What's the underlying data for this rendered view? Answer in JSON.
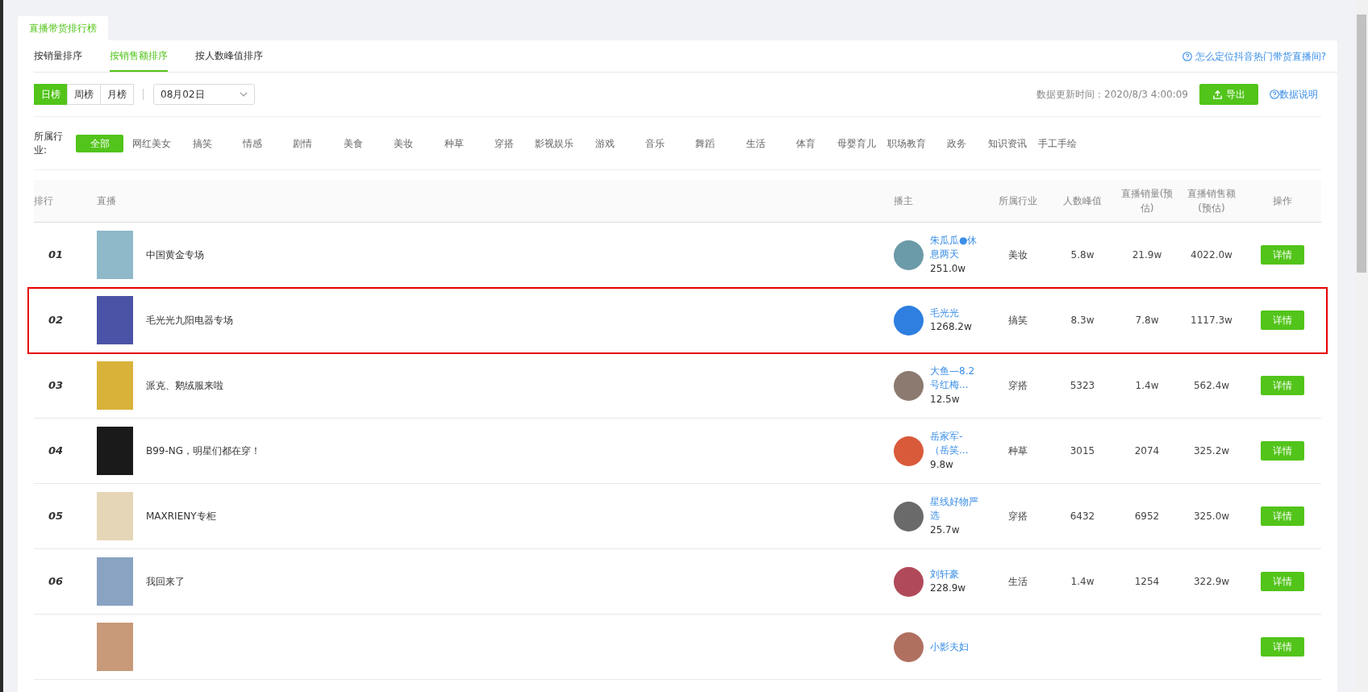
{
  "page_tab": {
    "label": "直播带货排行榜"
  },
  "sort_tabs": [
    {
      "label": "按销量排序",
      "selected": false
    },
    {
      "label": "按销售额排序",
      "selected": true
    },
    {
      "label": "按人数峰值排序",
      "selected": false
    }
  ],
  "help_link": "怎么定位抖音热门带货直播间?",
  "period_buttons": [
    {
      "label": "日榜",
      "selected": true
    },
    {
      "label": "周榜",
      "selected": false
    },
    {
      "label": "月榜",
      "selected": false
    }
  ],
  "date_select": {
    "value": "08月02日"
  },
  "update_time": "数据更新时间：2020/8/3 4:00:09",
  "export_button": "导出",
  "data_note_link": "数据说明",
  "industry_filter": {
    "label": "所属行业:",
    "options": [
      {
        "label": "全部",
        "selected": true
      },
      {
        "label": "网红美女",
        "selected": false
      },
      {
        "label": "搞笑",
        "selected": false
      },
      {
        "label": "情感",
        "selected": false
      },
      {
        "label": "剧情",
        "selected": false
      },
      {
        "label": "美食",
        "selected": false
      },
      {
        "label": "美妆",
        "selected": false
      },
      {
        "label": "种草",
        "selected": false
      },
      {
        "label": "穿搭",
        "selected": false
      },
      {
        "label": "影视娱乐",
        "selected": false
      },
      {
        "label": "游戏",
        "selected": false
      },
      {
        "label": "音乐",
        "selected": false
      },
      {
        "label": "舞蹈",
        "selected": false
      },
      {
        "label": "生活",
        "selected": false
      },
      {
        "label": "体育",
        "selected": false
      },
      {
        "label": "母婴育儿",
        "selected": false
      },
      {
        "label": "职场教育",
        "selected": false
      },
      {
        "label": "政务",
        "selected": false
      },
      {
        "label": "知识资讯",
        "selected": false
      },
      {
        "label": "手工手绘",
        "selected": false
      }
    ]
  },
  "table": {
    "columns": [
      "排行",
      "直播",
      "播主",
      "所属行业",
      "人数峰值",
      "直播销量(预估)",
      "直播销售额(预估)",
      "操作"
    ],
    "rows": [
      {
        "rank": "01",
        "title": "中国黄金专场",
        "anchor_name": "朱瓜瓜●休息两天",
        "anchor_fans": "251.0w",
        "industry": "美妆",
        "peak": "5.8w",
        "sales": "21.9w",
        "amount": "4022.0w",
        "action": "详情",
        "highlighted": false
      },
      {
        "rank": "02",
        "title": "毛光光九阳电器专场",
        "anchor_name": "毛光光",
        "anchor_fans": "1268.2w",
        "industry": "搞笑",
        "peak": "8.3w",
        "sales": "7.8w",
        "amount": "1117.3w",
        "action": "详情",
        "highlighted": true
      },
      {
        "rank": "03",
        "title": "派克、鹅绒服来啦",
        "anchor_name": "大鱼—8.2号红梅...",
        "anchor_fans": "12.5w",
        "industry": "穿搭",
        "peak": "5323",
        "sales": "1.4w",
        "amount": "562.4w",
        "action": "详情",
        "highlighted": false
      },
      {
        "rank": "04",
        "title": "B99-NG，明星们都在穿！",
        "anchor_name": "岳家军-（岳笑...",
        "anchor_fans": "9.8w",
        "industry": "种草",
        "peak": "3015",
        "sales": "2074",
        "amount": "325.2w",
        "action": "详情",
        "highlighted": false
      },
      {
        "rank": "05",
        "title": "MAXRIENY专柜",
        "anchor_name": "星线好物严选",
        "anchor_fans": "25.7w",
        "industry": "穿搭",
        "peak": "6432",
        "sales": "6952",
        "amount": "325.0w",
        "action": "详情",
        "highlighted": false
      },
      {
        "rank": "06",
        "title": "我回来了",
        "anchor_name": "刘轩豪",
        "anchor_fans": "228.9w",
        "industry": "生活",
        "peak": "1.4w",
        "sales": "1254",
        "amount": "322.9w",
        "action": "详情",
        "highlighted": false
      },
      {
        "anchor_name": "小影夫妇",
        "action": "详情",
        "highlighted": false
      }
    ]
  }
}
